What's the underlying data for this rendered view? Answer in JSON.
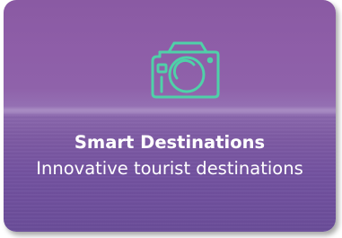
{
  "card": {
    "title": "Smart Destinations",
    "subtitle": "Innovative tourist destinations",
    "icon": "camera-icon",
    "icon_color": "#4fd1a8",
    "text_color": "#ffffff"
  }
}
